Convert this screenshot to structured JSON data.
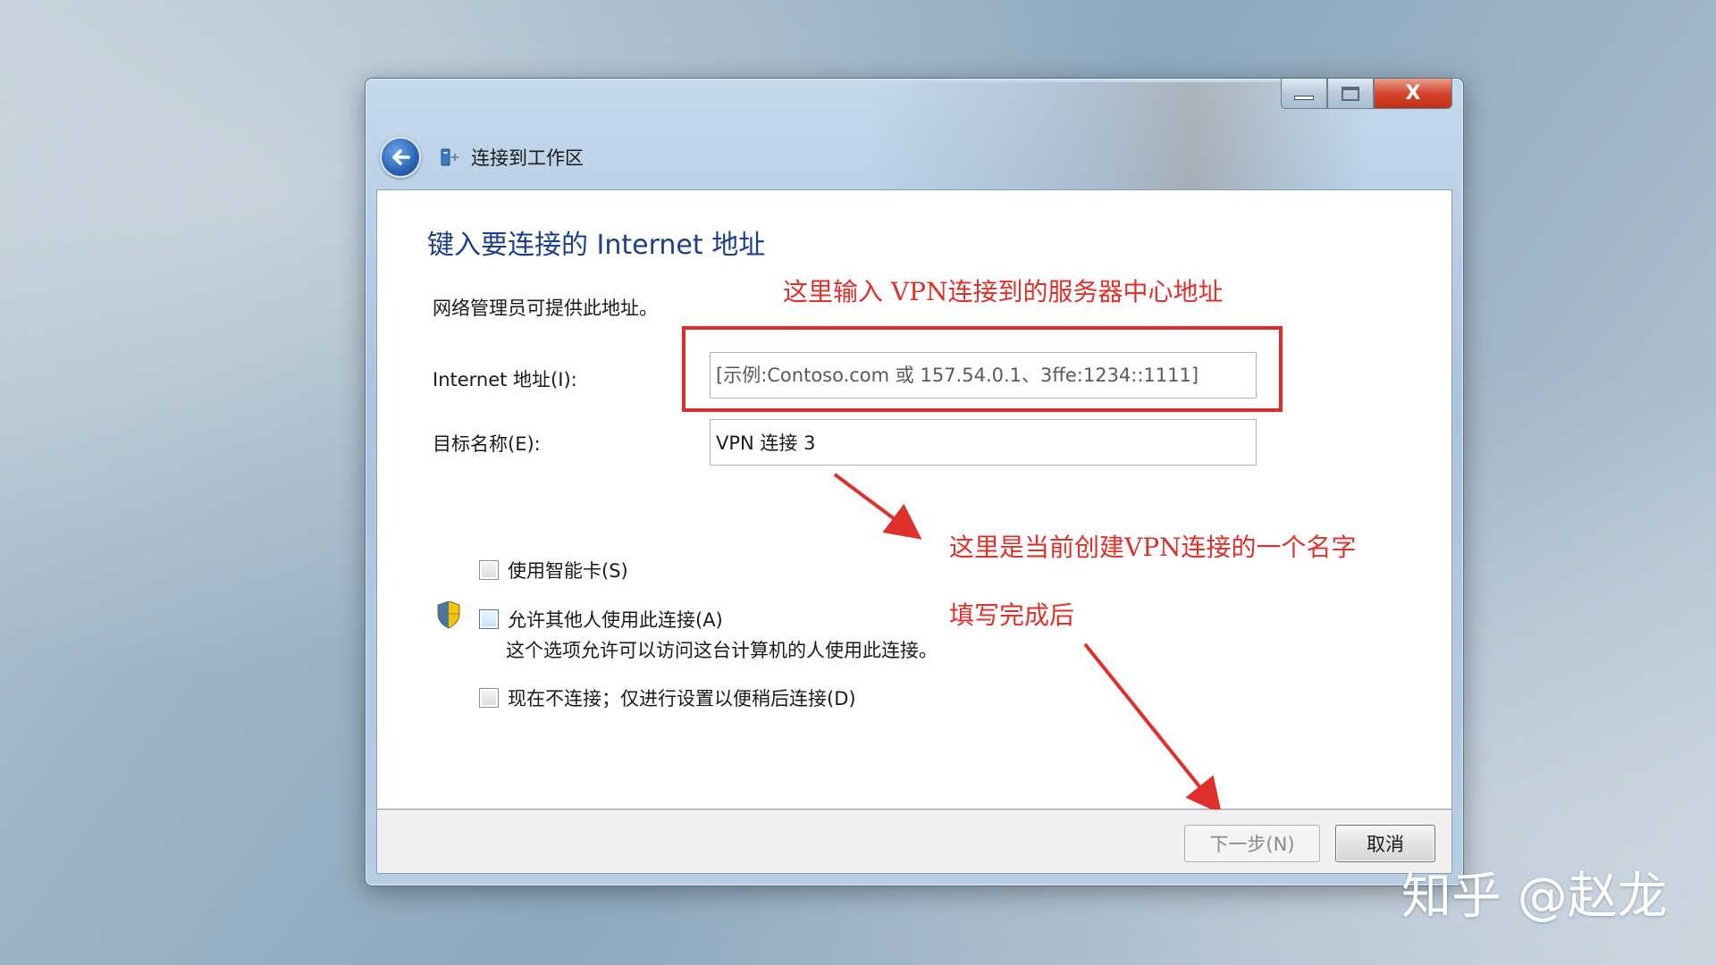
{
  "window": {
    "nav_title": "连接到工作区",
    "caption": {
      "minimize": "minimize",
      "maximize": "maximize",
      "close": "X"
    }
  },
  "content": {
    "heading": "键入要连接的 Internet 地址",
    "description": "网络管理员可提供此地址。",
    "internet_address_label": "Internet 地址(I):",
    "internet_address_placeholder": "[示例:Contoso.com 或 157.54.0.1、3ffe:1234::1111]",
    "internet_address_value": "",
    "destination_name_label": "目标名称(E):",
    "destination_name_value": "VPN 连接 3",
    "options": [
      {
        "label": "使用智能卡(S)",
        "checked": false
      },
      {
        "label": "允许其他人使用此连接(A)",
        "checked": false,
        "note": "这个选项允许可以访问这台计算机的人使用此连接。"
      },
      {
        "label": "现在不连接；仅进行设置以便稍后连接(D)",
        "checked": false
      }
    ]
  },
  "annotations": {
    "address_hint": "这里输入 VPN连接到的服务器中心地址",
    "name_hint": "这里是当前创建VPN连接的一个名字",
    "after_hint": "填写完成后",
    "color": "#e0302c"
  },
  "footer": {
    "next_label": "下一步(N)",
    "cancel_label": "取消"
  },
  "watermark": "知乎 @赵龙",
  "icons": {
    "back": "back-arrow-icon",
    "network": "network-icon",
    "shield": "uac-shield-icon"
  }
}
